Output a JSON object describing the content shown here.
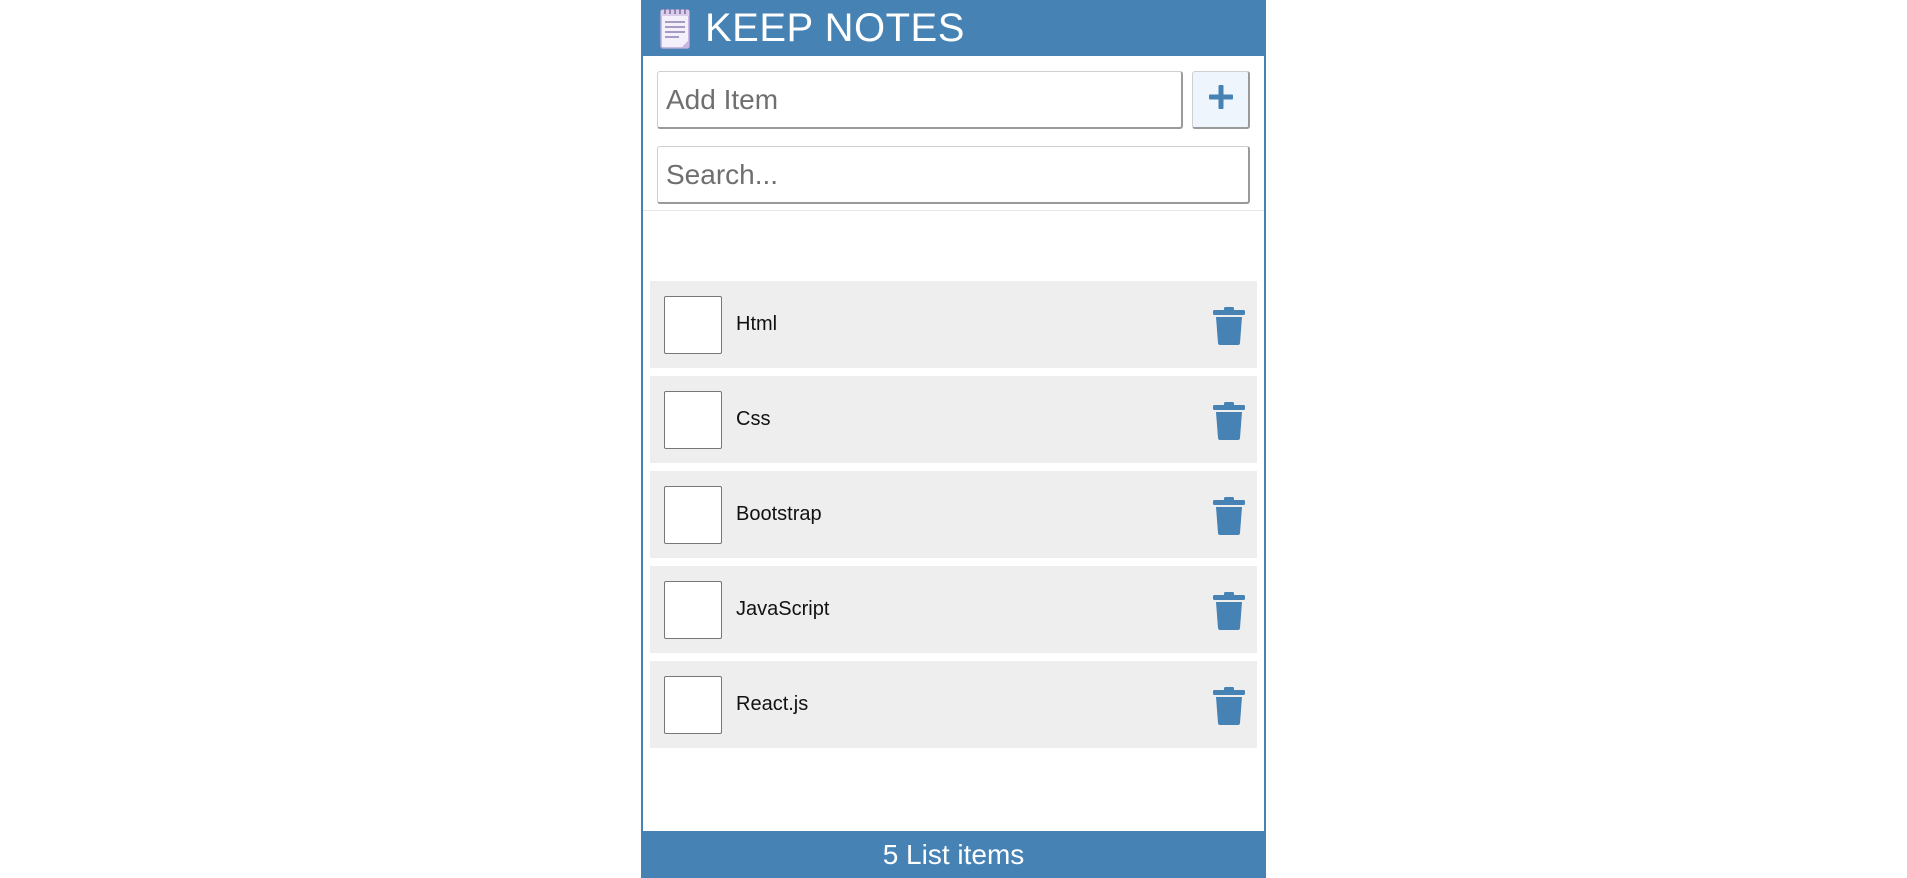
{
  "header": {
    "title": "KEEP NOTES",
    "logo_icon": "notepad-icon"
  },
  "add_item": {
    "placeholder": "Add Item",
    "value": "",
    "button_icon": "plus-icon"
  },
  "search": {
    "placeholder": "Search...",
    "value": ""
  },
  "list": {
    "items": [
      {
        "label": "Html",
        "checked": false
      },
      {
        "label": "Css",
        "checked": false
      },
      {
        "label": "Bootstrap",
        "checked": false
      },
      {
        "label": "JavaScript",
        "checked": false
      },
      {
        "label": "React.js",
        "checked": false
      }
    ],
    "delete_icon": "trash-icon"
  },
  "footer": {
    "text": "5 List items"
  },
  "colors": {
    "primary": "#4682b4",
    "item_bg": "#eeeeee",
    "add_button_bg": "#eef5fc"
  }
}
